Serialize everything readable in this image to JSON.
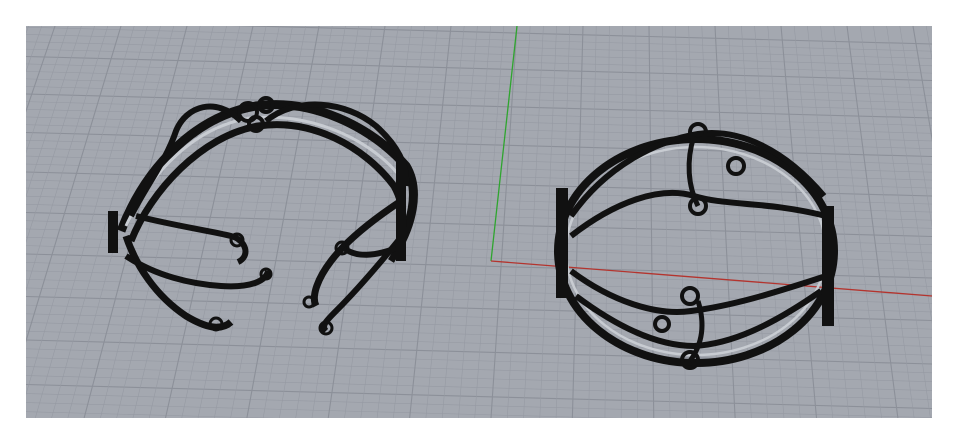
{
  "viewport": {
    "view": "perspective",
    "background_color": "#a4a8b0",
    "grid_minor_color": "#969aa3",
    "grid_major_color": "#8c9099",
    "x_axis_color": "#b4342e",
    "y_axis_color": "#2fa52f",
    "wire_color": "#111111"
  },
  "objects": [
    {
      "name": "open-cuff-bracelet",
      "display": "wireframe"
    },
    {
      "name": "closed-bangle-bracelet",
      "display": "wireframe"
    }
  ]
}
